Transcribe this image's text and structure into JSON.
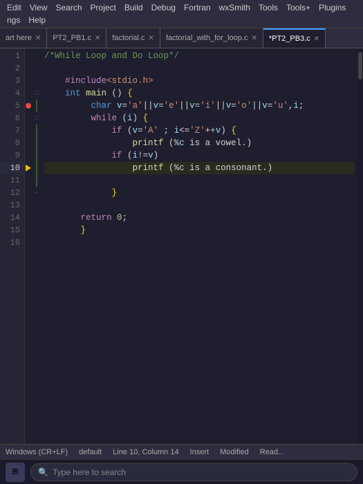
{
  "menubar": {
    "items": [
      "Edit",
      "View",
      "Search",
      "Project",
      "Build",
      "Debug",
      "Fortran",
      "wxSmith",
      "Tools",
      "Tools+",
      "Plugins",
      "ngs",
      "Help"
    ]
  },
  "tabs": [
    {
      "label": "art here",
      "active": false,
      "modified": false
    },
    {
      "label": "PT2_PB1.c",
      "active": false,
      "modified": false
    },
    {
      "label": "factorial.c",
      "active": false,
      "modified": false
    },
    {
      "label": "factorial_with_for_loop.c",
      "active": false,
      "modified": false
    },
    {
      "label": "*PT2_PB3.c",
      "active": true,
      "modified": true
    }
  ],
  "code": {
    "comment": "/*While Loop and Do Loop*/",
    "lines": [
      {
        "num": 1,
        "content": "/*While Loop and Do Loop*/"
      },
      {
        "num": 2,
        "content": ""
      },
      {
        "num": 3,
        "content": "\t#include<stdio.h>"
      },
      {
        "num": 4,
        "content": "\tint main () {"
      },
      {
        "num": 5,
        "content": "\t\t\tchar v='a'||v='e'||v='i'||v='o'||v='u',i;"
      },
      {
        "num": 6,
        "content": "\t\t\twhile (i) {"
      },
      {
        "num": 7,
        "content": "\t\t\t\tif (v='A' ; i<='Z'++v) {"
      },
      {
        "num": 8,
        "content": "\t\t\t\t\tprintf (%c is a vowel.)"
      },
      {
        "num": 9,
        "content": "\t\t\t\tif (i!=v)"
      },
      {
        "num": 10,
        "content": "\t\t\t\t\tprintf (%c is a consonant.)"
      },
      {
        "num": 11,
        "content": ""
      },
      {
        "num": 12,
        "content": "\t\t\t-\t}"
      },
      {
        "num": 13,
        "content": ""
      },
      {
        "num": 14,
        "content": "\t\treturn 0;"
      },
      {
        "num": 15,
        "content": "\t\t}"
      },
      {
        "num": 16,
        "content": ""
      }
    ]
  },
  "statusbar": {
    "encoding": "Windows (CR+LF)",
    "language": "default",
    "position": "Line 10, Column 14",
    "insert": "Insert",
    "modified": "Modified",
    "readonly": "Read..."
  },
  "taskbar": {
    "search_placeholder": "Type here to search",
    "search_icon": "🔍"
  }
}
